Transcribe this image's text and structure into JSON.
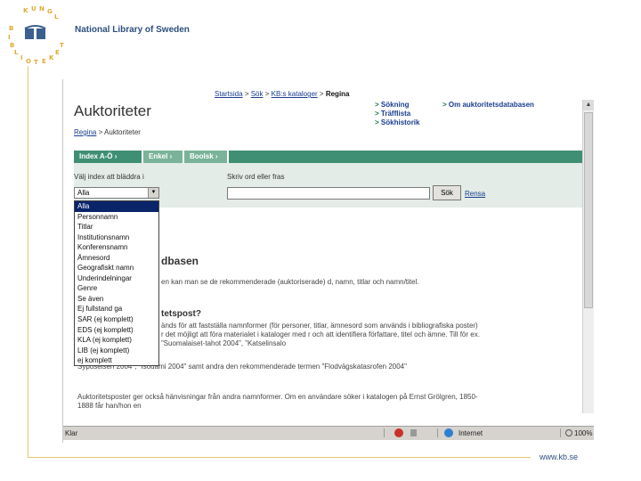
{
  "slide": {
    "brand": "National Library of Sweden",
    "logo_text": "KUNGL BIBLIOTEKET",
    "footer_url": "www.kb.se"
  },
  "browser": {
    "breadcrumb": {
      "items": [
        "Startsida",
        "Sök",
        "KB:s kataloger"
      ],
      "current": "Regina",
      "separator": ">"
    },
    "page_title": "Auktoriteter",
    "quick_links": [
      "Sökning",
      "Träfflista",
      "Sökhistorik"
    ],
    "quick_link_right": "Om auktoritetsdatabasen",
    "sub_breadcrumb": {
      "link": "Regina",
      "separator": ">",
      "current": "Auktoriteter"
    },
    "tabs": [
      "Index A-Ö",
      "Enkel",
      "Boolsk"
    ],
    "form": {
      "select_label": "Välj index att bläddra i",
      "select_value": "Alla",
      "input_label": "Skriv ord eller fras",
      "search_button": "Sök",
      "clear_link": "Rensa"
    },
    "dropdown_options": [
      "Alla",
      "Personnamn",
      "Titlar",
      "Institutionsnamn",
      "Konferensnamn",
      "Ämnesord",
      "Geografiskt namn",
      "Underindelningar",
      "Genre",
      "Se även",
      "Ej fullstand ga",
      "SAR (ej komplett)",
      "EDS (ej komplett)",
      "KLA (ej komplett)",
      "LIB (ej komplett)",
      "ej komplett"
    ],
    "body": {
      "heading": "dbasen",
      "text1": "en kan man se de rekommenderade (auktoriserade) d, namn, titlar och namn/titel.",
      "question": "tetspost?",
      "text2": "änds för att fastställa namnformer (för personer, titlar, ämnesord som används i bibliografiska poster) r det möjligt att föra materialet i kataloger med r och att identifiera författare, titel och ämne. Till för ex. ”Suomalaiset-tahot 2004”, ”Katselinsalo",
      "text3": "Sypuseisen 2004\", \"Isouami 2004\" samt andra den rekommenderade termen \"Flodvägskatasrofen 2004\"",
      "text4": "Auktoritetsposter ger också hänvisningar från andra namnformer. Om en användare söker i katalogen på Ernst Grölgren, 1850-1888 får han/hon en"
    },
    "status": {
      "text": "Klar",
      "zone": "Internet",
      "zoom": "100%"
    }
  }
}
